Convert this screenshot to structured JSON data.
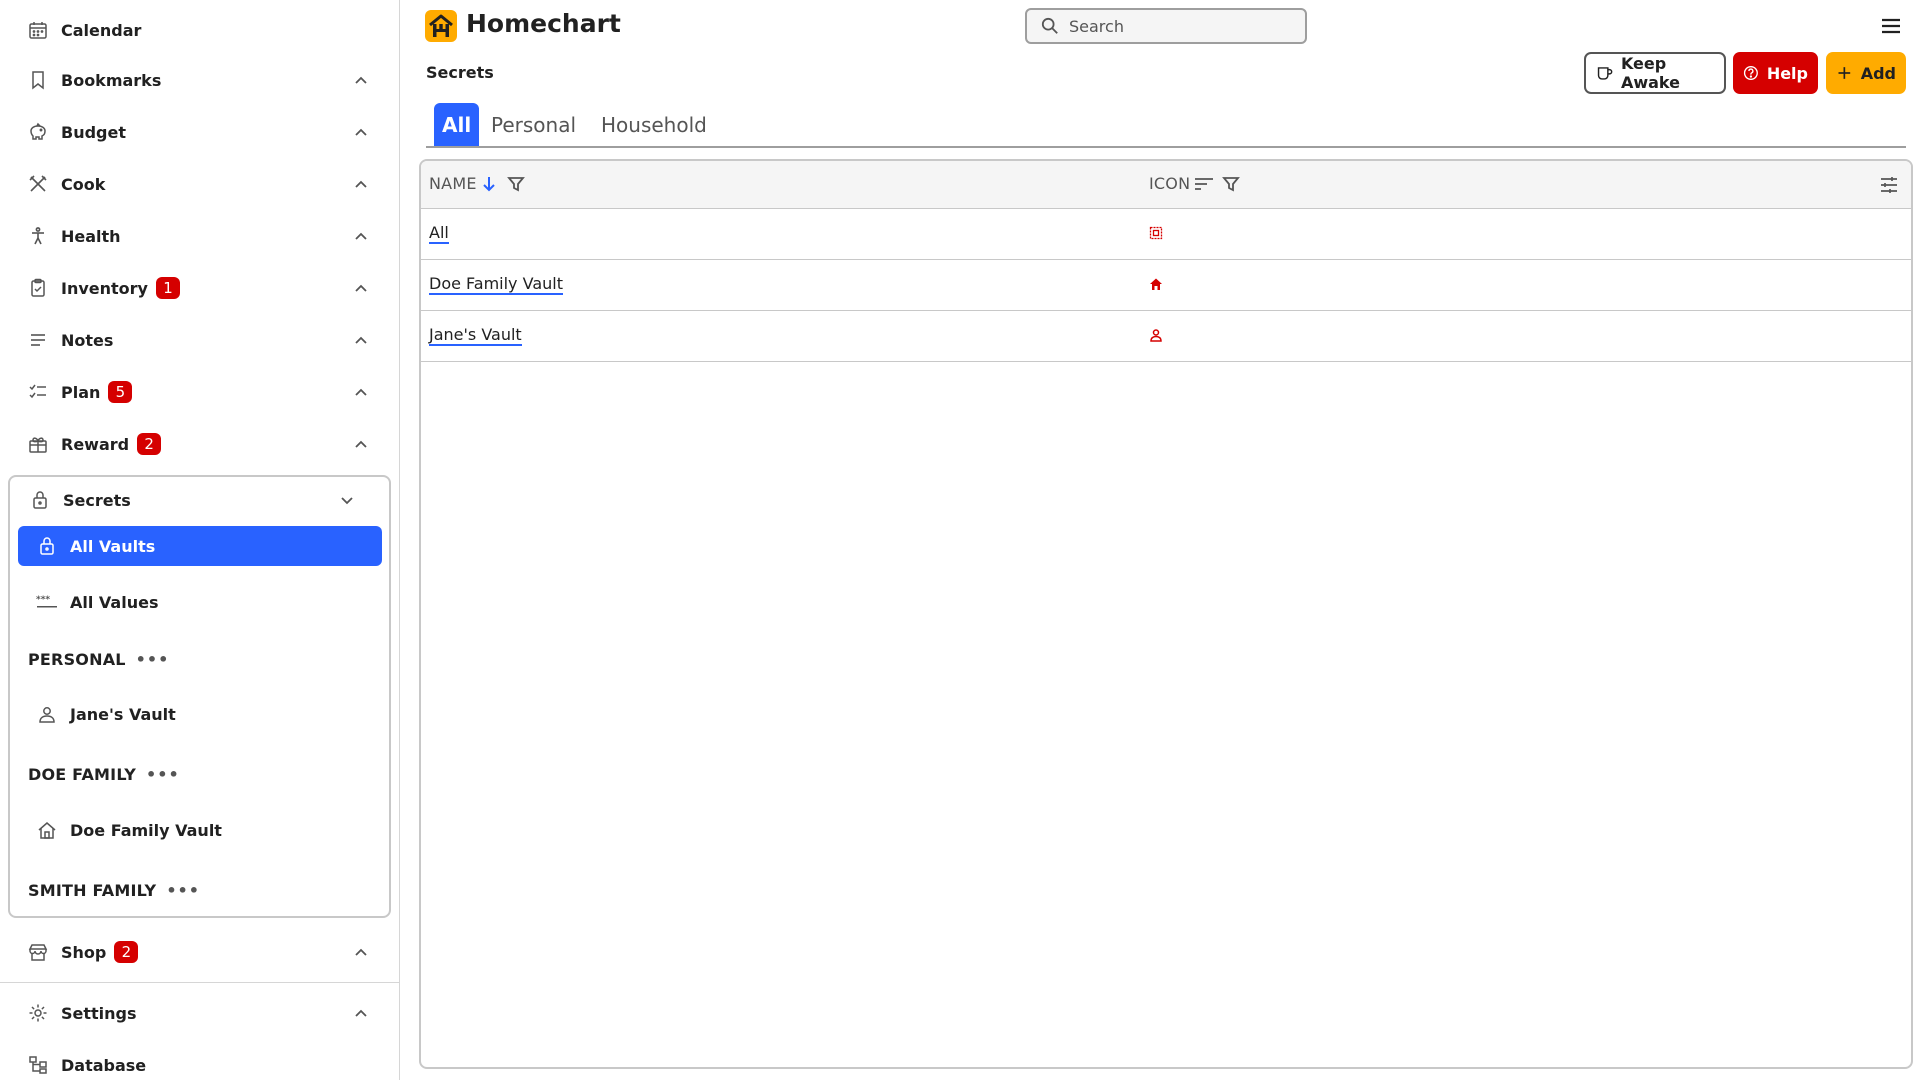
{
  "app": {
    "title": "Homechart"
  },
  "search": {
    "placeholder": "Search"
  },
  "sidebar": {
    "items": [
      {
        "label": "Calendar"
      },
      {
        "label": "Bookmarks"
      },
      {
        "label": "Budget"
      },
      {
        "label": "Cook"
      },
      {
        "label": "Health"
      },
      {
        "label": "Inventory",
        "badge": "1"
      },
      {
        "label": "Notes"
      },
      {
        "label": "Plan",
        "badge": "5"
      },
      {
        "label": "Reward",
        "badge": "2"
      }
    ],
    "secrets": {
      "label": "Secrets",
      "sub": {
        "all_vaults": "All Vaults",
        "all_values": "All Values"
      },
      "groups": [
        {
          "label": "PERSONAL",
          "vault": "Jane's Vault"
        },
        {
          "label": "DOE FAMILY",
          "vault": "Doe Family Vault"
        },
        {
          "label": "SMITH FAMILY"
        }
      ]
    },
    "bottom": [
      {
        "label": "Shop",
        "badge": "2"
      },
      {
        "label": "Settings"
      },
      {
        "label": "Database"
      }
    ]
  },
  "page": {
    "title": "Secrets"
  },
  "actions": {
    "keep_awake": "Keep Awake",
    "help": "Help",
    "add": "Add"
  },
  "tabs": [
    "All",
    "Personal",
    "Household"
  ],
  "table": {
    "columns": [
      "NAME",
      "ICON"
    ],
    "rows": [
      {
        "name": "All",
        "icon": "all-vaults-icon"
      },
      {
        "name": "Doe Family Vault",
        "icon": "household-icon"
      },
      {
        "name": "Jane's Vault",
        "icon": "person-icon"
      }
    ]
  },
  "colors": {
    "primary": "#2962ff",
    "danger": "#d50000",
    "accent": "#ffab00"
  }
}
